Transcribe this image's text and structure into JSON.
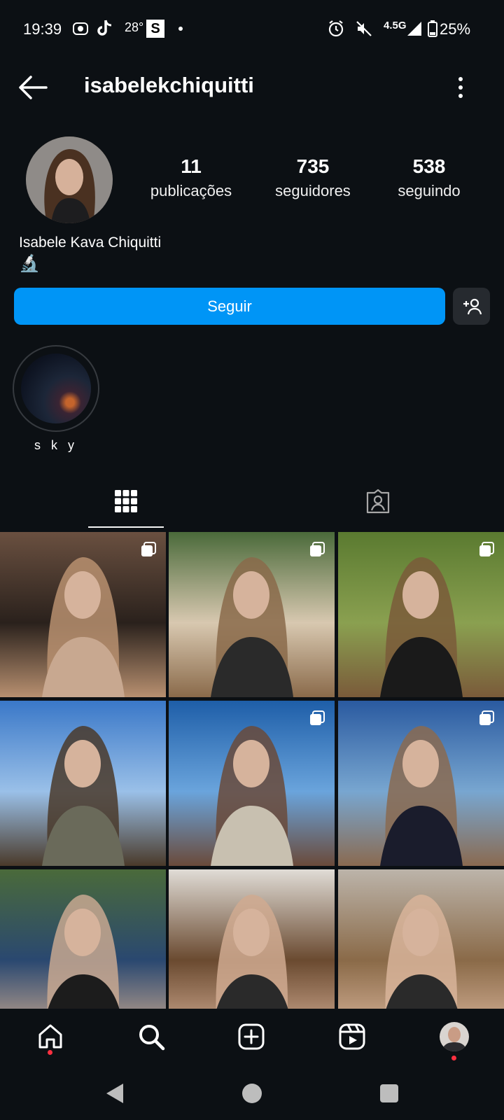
{
  "status_bar": {
    "time": "19:39",
    "temperature": "28°",
    "network": "4.5G",
    "battery": "25%",
    "icons": [
      "record-icon",
      "tiktok-icon",
      "s-app-icon",
      "dot-icon",
      "alarm-icon",
      "mute-icon",
      "signal-icon",
      "battery-icon"
    ]
  },
  "header": {
    "username": "isabelekchiquitti",
    "back_icon": "back-arrow-icon",
    "menu_icon": "kebab-menu-icon"
  },
  "profile": {
    "posts_count": "11",
    "posts_label": "publicações",
    "followers_count": "735",
    "followers_label": "seguidores",
    "following_count": "538",
    "following_label": "seguindo",
    "full_name": "Isabele Kava Chiquitti",
    "bio_emoji": "🔬"
  },
  "actions": {
    "follow_label": "Seguir",
    "add_user_icon": "add-person-icon"
  },
  "highlights": [
    {
      "label": "s k y"
    }
  ],
  "tabs": {
    "grid_icon": "grid-icon",
    "tagged_icon": "tagged-icon"
  },
  "grid": [
    {
      "multi": true
    },
    {
      "multi": true
    },
    {
      "multi": true
    },
    {
      "multi": false
    },
    {
      "multi": true
    },
    {
      "multi": true
    },
    {
      "multi": false
    },
    {
      "multi": false
    },
    {
      "multi": false
    }
  ],
  "bottom_nav": {
    "items": [
      "home-icon",
      "search-icon",
      "create-icon",
      "reels-icon",
      "profile-avatar"
    ],
    "accent": "#0095f6",
    "notify_color": "#ff3040"
  }
}
